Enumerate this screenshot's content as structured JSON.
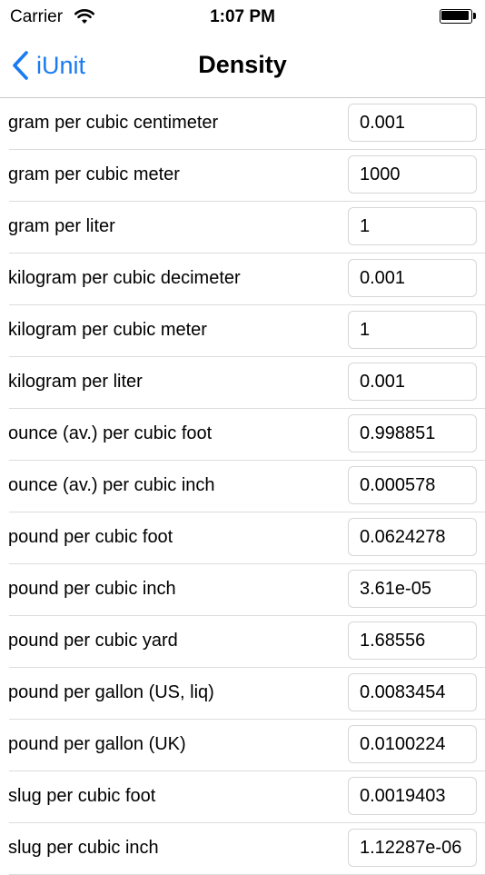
{
  "status_bar": {
    "carrier": "Carrier",
    "time": "1:07 PM"
  },
  "nav": {
    "back_label": "iUnit",
    "title": "Density"
  },
  "units": [
    {
      "name": "gram per cubic centimeter",
      "value": "0.001"
    },
    {
      "name": "gram per cubic meter",
      "value": "1000"
    },
    {
      "name": "gram per liter",
      "value": "1"
    },
    {
      "name": "kilogram per cubic decimeter",
      "value": "0.001"
    },
    {
      "name": "kilogram per cubic meter",
      "value": "1"
    },
    {
      "name": "kilogram per liter",
      "value": "0.001"
    },
    {
      "name": "ounce (av.) per cubic foot",
      "value": "0.998851"
    },
    {
      "name": "ounce (av.) per cubic inch",
      "value": "0.000578"
    },
    {
      "name": "pound per cubic foot",
      "value": "0.0624278"
    },
    {
      "name": "pound per cubic inch",
      "value": "3.61e-05"
    },
    {
      "name": "pound per cubic yard",
      "value": "1.68556"
    },
    {
      "name": "pound per gallon (US, liq)",
      "value": "0.0083454"
    },
    {
      "name": "pound per gallon (UK)",
      "value": "0.0100224"
    },
    {
      "name": "slug per cubic foot",
      "value": "0.0019403"
    },
    {
      "name": "slug per cubic inch",
      "value": "1.12287e-06"
    }
  ],
  "colors": {
    "accent": "#1a7bf2",
    "separator": "#dcdcdf",
    "field_border": "#d6d6d9"
  },
  "icons": {
    "back": "chevron-left-icon",
    "wifi": "wifi-icon",
    "battery": "battery-icon"
  }
}
